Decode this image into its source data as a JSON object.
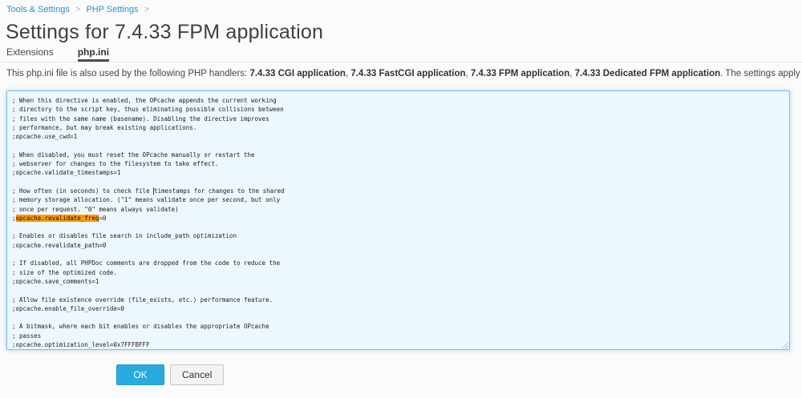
{
  "breadcrumb": {
    "items": [
      {
        "label": "Tools & Settings"
      },
      {
        "label": "PHP Settings"
      }
    ],
    "separator": ">"
  },
  "page": {
    "title": "Settings for 7.4.33 FPM application"
  },
  "tabs": [
    {
      "label": "Extensions",
      "active": false
    },
    {
      "label": "php.ini",
      "active": true
    }
  ],
  "description": {
    "prefix": "This php.ini file is also used by the following PHP handlers: ",
    "handlers": [
      "7.4.33 CGI application",
      "7.4.33 FastCGI application",
      "7.4.33 FPM application",
      "7.4.33 Dedicated FPM application"
    ],
    "suffix": ". The settings apply to all websites that use these handlers."
  },
  "editor": {
    "lines": [
      "; When this directive is enabled, the OPcache appends the current working",
      "; directory to the script key, thus eliminating possible collisions between",
      "; files with the same name (basename). Disabling the directive improves",
      "; performance, but may break existing applications.",
      ";opcache.use_cwd=1",
      "",
      "; When disabled, you must reset the OPcache manually or restart the",
      "; webserver for changes to the filesystem to take effect.",
      ";opcache.validate_timestamps=1",
      "",
      "; How often (in seconds) to check file timestamps for changes to the shared",
      "; memory storage allocation. (\"1\" means validate once per second, but only",
      "; once per request. \"0\" means always validate)",
      ";opcache.revalidate_freq=0",
      "",
      "; Enables or disables file search in include_path optimization",
      ";opcache.revalidate_path=0",
      "",
      "; If disabled, all PHPDoc comments are dropped from the code to reduce the",
      "; size of the optimized code.",
      ";opcache.save_comments=1",
      "",
      "; Allow file existence override (file_exists, etc.) performance feature.",
      ";opcache.enable_file_override=0",
      "",
      "; A bitmask, where each bit enables or disables the appropriate OPcache",
      "; passes",
      ";opcache.optimization_level=0x7FFFBFFF"
    ],
    "highlight": {
      "line": 13,
      "text": "opcache.revalidate_freq",
      "color": "#ff9900"
    },
    "caret": {
      "line": 10,
      "after_text": "; How often (in seconds) to check file "
    }
  },
  "buttons": {
    "ok": "OK",
    "cancel": "Cancel"
  },
  "colors": {
    "link_blue": "#2a93c9",
    "primary_button": "#28aade",
    "editor_background": "#edf7fe",
    "editor_border": "#76c0e8",
    "highlight_orange": "#ff9900"
  }
}
